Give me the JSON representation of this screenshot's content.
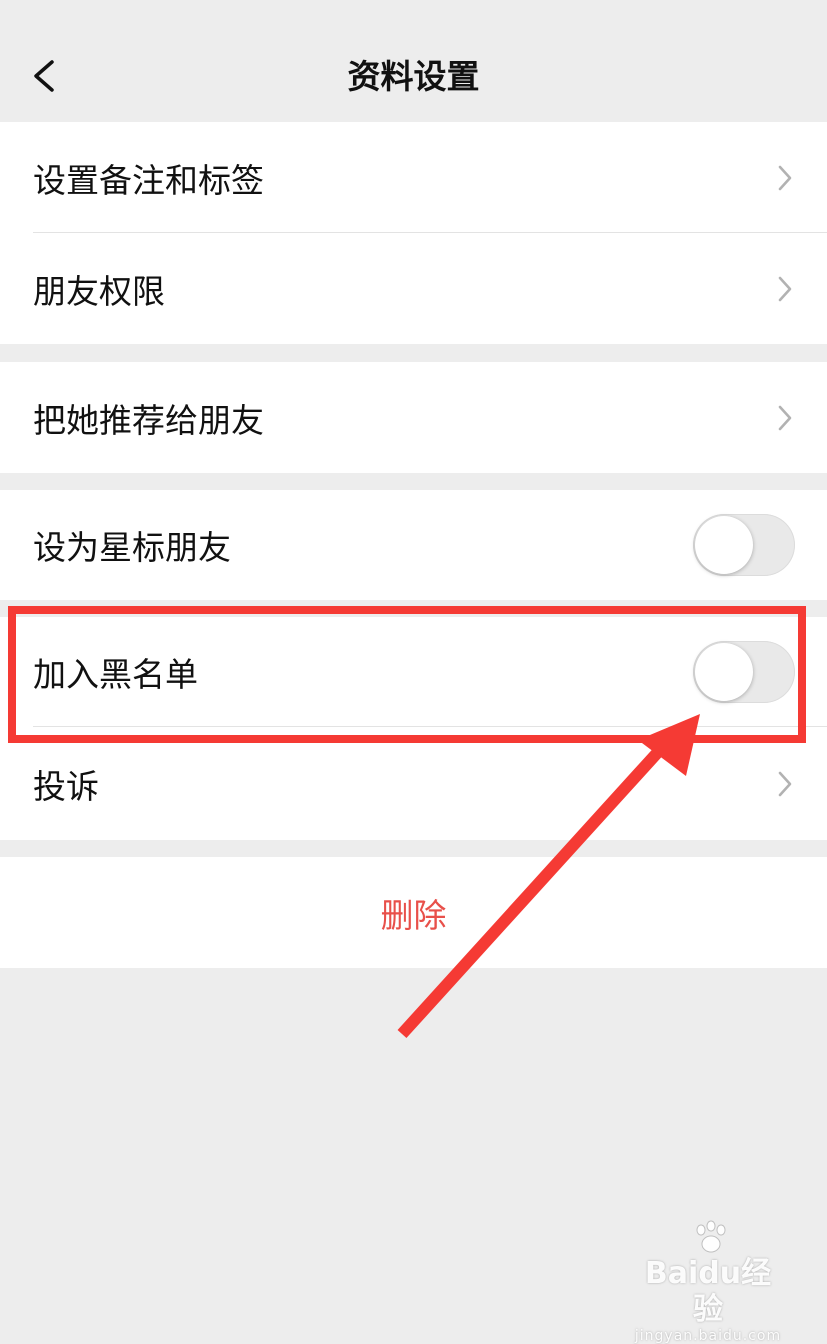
{
  "header": {
    "title": "资料设置",
    "back_icon": "chevron-left-icon"
  },
  "groups": {
    "remark_permissions": {
      "items": [
        {
          "label": "设置备注和标签",
          "control": "chevron-right-icon"
        },
        {
          "label": "朋友权限",
          "control": "chevron-right-icon"
        }
      ]
    },
    "recommend": {
      "items": [
        {
          "label": "把她推荐给朋友",
          "control": "chevron-right-icon"
        }
      ]
    },
    "star_blacklist_report": {
      "items": [
        {
          "label": "设为星标朋友",
          "control": "toggle",
          "on": false
        },
        {
          "label": "加入黑名单",
          "control": "toggle",
          "on": false
        },
        {
          "label": "投诉",
          "control": "chevron-right-icon"
        }
      ]
    },
    "delete": {
      "label": "删除"
    }
  },
  "annotation": {
    "highlight_color": "#f53a34",
    "arrow_color": "#f53a34"
  },
  "watermark": {
    "logo": "Baidu经验",
    "sub": "jingyan.baidu.com"
  },
  "colors": {
    "background": "#ededed",
    "cell": "#ffffff",
    "delete_text": "#e8504a"
  }
}
